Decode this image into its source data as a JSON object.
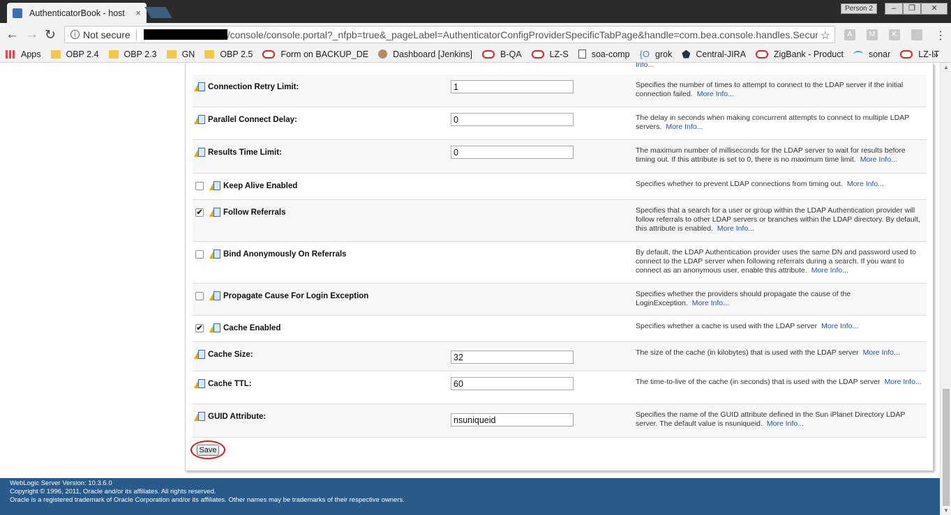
{
  "browser": {
    "tab_title": "AuthenticatorBook - host",
    "tab_close": "×",
    "profile": "Person 2",
    "win_min": "–",
    "win_max": "❐",
    "win_close": "✕",
    "not_secure": "Not secure",
    "url_rest": "/console/console.portal?_nfpb=true&_pageLabel=AuthenticatorConfigProviderSpecificTabPage&handle=com.bea.console.handles.Security",
    "bookmarks": [
      "Apps",
      "OBP 2.4",
      "OBP 2.3",
      "GN",
      "OBP 2.5",
      "Form on BACKUP_DE",
      "Dashboard [Jenkins]",
      "B-QA",
      "LZ-S",
      "soa-comp",
      "grok",
      "Central-JIRA",
      "ZigBank - Product",
      "sonar",
      "LZ-IT"
    ],
    "more": "»"
  },
  "settings": {
    "partial_top": "Info...",
    "more_info": "More Info...",
    "rows": [
      {
        "label": "Connection Retry Limit:",
        "value": "1",
        "desc": "Specifies the number of times to attempt to connect to the LDAP server if the initial connection failed."
      },
      {
        "label": "Parallel Connect Delay:",
        "value": "0",
        "desc": "The delay in seconds when making concurrent attempts to connect to multiple LDAP servers."
      },
      {
        "label": "Results Time Limit:",
        "value": "0",
        "desc": "The maximum number of milliseconds for the LDAP server to wait for results before timing out. If this attribute is set to 0, there is no maximum time limit."
      },
      {
        "label": "Keep Alive Enabled",
        "checked": false,
        "desc": "Specifies whether to prevent LDAP connections from timing out."
      },
      {
        "label": "Follow Referrals",
        "checked": true,
        "desc": "Specifies that a search for a user or group within the LDAP Authentication provider will follow referrals to other LDAP servers or branches within the LDAP directory. By default, this attribute is enabled."
      },
      {
        "label": "Bind Anonymously On Referrals",
        "checked": false,
        "desc": "By default, the LDAP Authentication provider uses the same DN and password used to connect to the LDAP server when following referrals during a search. If you want to connect as an anonymous user, enable this attribute."
      },
      {
        "label": "Propagate Cause For Login Exception",
        "checked": false,
        "desc": "Specifies whether the providers should propagate the cause of the LoginException."
      },
      {
        "label": "Cache Enabled",
        "checked": true,
        "desc": "Specifies whether a cache is used with the LDAP server"
      },
      {
        "label": "Cache Size:",
        "value": "32",
        "desc": "The size of the cache (in kilobytes) that is used with the LDAP server"
      },
      {
        "label": "Cache TTL:",
        "value": "60",
        "desc": "The time-to-live of the cache (in seconds) that is used with the LDAP server"
      },
      {
        "label": "GUID Attribute:",
        "value": "nsuniqueid",
        "desc": "Specifies the name of the GUID attribute defined in the Sun iPlanet Directory LDAP server. The default value is nsuniqueid."
      }
    ],
    "save_label": "Save"
  },
  "footer": {
    "version": "WebLogic Server Version: 10.3.6.0",
    "copyright": "Copyright © 1996, 2011, Oracle and/or its affiliates. All rights reserved.",
    "trademark": "Oracle is a registered trademark of Oracle Corporation and/or its affiliates. Other names may be trademarks of their respective owners."
  }
}
